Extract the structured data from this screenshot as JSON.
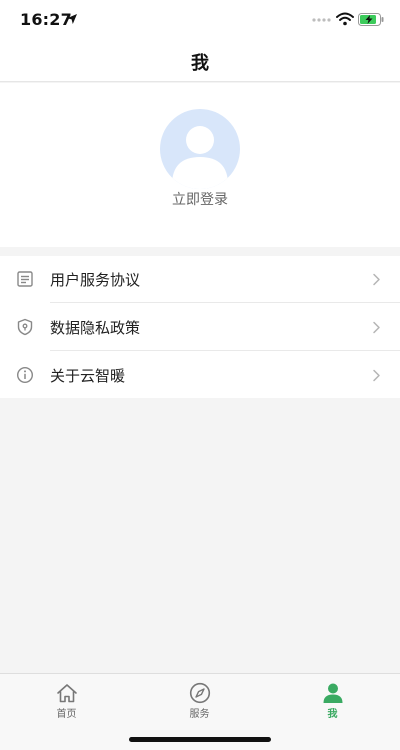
{
  "status_bar": {
    "time": "16:27"
  },
  "nav": {
    "title": "我"
  },
  "profile": {
    "login_label": "立即登录"
  },
  "menu": {
    "items": [
      {
        "label": "用户服务协议",
        "icon": "document-icon"
      },
      {
        "label": "数据隐私政策",
        "icon": "shield-icon"
      },
      {
        "label": "关于云智暖",
        "icon": "info-icon"
      }
    ]
  },
  "tabs": [
    {
      "label": "首页",
      "icon": "home-icon",
      "active": false
    },
    {
      "label": "服务",
      "icon": "compass-icon",
      "active": false
    },
    {
      "label": "我",
      "icon": "person-icon",
      "active": true
    }
  ],
  "colors": {
    "accent": "#3aaa62",
    "avatar_bg": "#d8e6fa",
    "page_bg": "#f4f4f4"
  }
}
